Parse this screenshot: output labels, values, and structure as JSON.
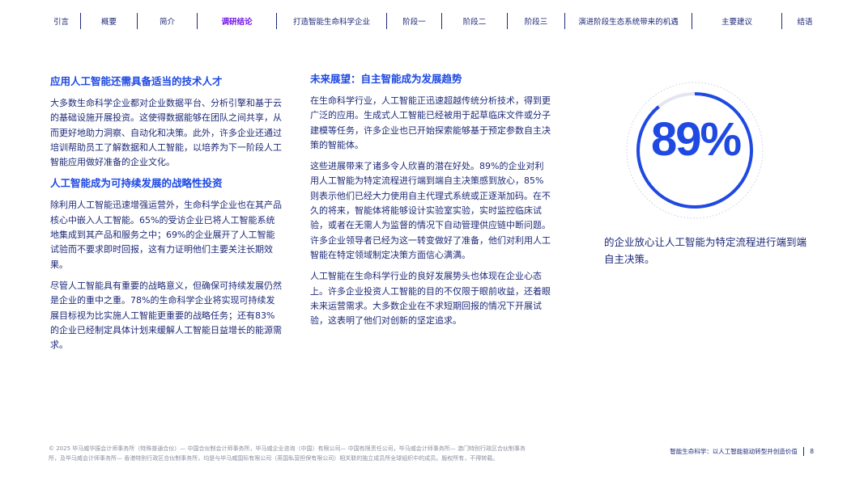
{
  "nav": {
    "items": [
      {
        "label": "引言",
        "w": 48
      },
      {
        "label": "概要",
        "w": 70
      },
      {
        "label": "简介",
        "w": 74
      },
      {
        "label": "调研结论",
        "w": 98,
        "active": true
      },
      {
        "label": "打造智能生命科学企业",
        "w": 136
      },
      {
        "label": "阶段一",
        "w": 68
      },
      {
        "label": "阶段二",
        "w": 81
      },
      {
        "label": "阶段三",
        "w": 71
      },
      {
        "label": "演进阶段生态系统带来的机遇",
        "w": 157
      },
      {
        "label": "主要建议",
        "w": 111
      },
      {
        "label": "结语",
        "w": 56
      }
    ]
  },
  "left": {
    "h1": "应用人工智能还需具备适当的技术人才",
    "p1": "大多数生命科学企业都对企业数据平台、分析引擎和基于云的基础设施开展投资。这使得数据能够在团队之间共享，从而更好地助力洞察、自动化和决策。此外，许多企业还通过培训帮助员工了解数据和人工智能，以培养为下一阶段人工智能应用做好准备的企业文化。",
    "h2": "人工智能成为可持续发展的战略性投资",
    "p2": "除利用人工智能迅速增强运营外，生命科学企业也在其产品核心中嵌入人工智能。65%的受访企业已将人工智能系统地集成到其产品和服务之中；69%的企业展开了人工智能试验而不要求即时回报，这有力证明他们主要关注长期效果。",
    "p3": "尽管人工智能具有重要的战略意义，但确保可持续发展仍然是企业的重中之重。78%的生命科学企业将实现可持续发展目标视为比实施人工智能更重要的战略任务；还有83%的企业已经制定具体计划来缓解人工智能日益增长的能源需求。"
  },
  "mid": {
    "h1": "未来展望：自主智能成为发展趋势",
    "p1": "在生命科学行业，人工智能正迅速超越传统分析技术，得到更广泛的应用。生成式人工智能已经被用于起草临床文件或分子建模等任务，许多企业也已开始探索能够基于预定参数自主决策的智能体。",
    "p2": "这些进展带来了诸多令人欣喜的潜在好处。89%的企业对利用人工智能为特定流程进行端到端自主决策感到放心，85%则表示他们已经大力使用自主代理式系统或正逐渐加码。在不久的将来，智能体将能够设计实验室实验，实时监控临床试验，或者在无需人为监督的情况下自动管理供应链中断问题。许多企业领导者已经为这一转变做好了准备，他们对利用人工智能在特定领域制定决策方面信心满满。",
    "p3": "人工智能在生命科学行业的良好发展势头也体现在企业心态上。许多企业投资人工智能的目的不仅限于眼前收益，还着眼未来运营需求。大多数企业在不求短期回报的情况下开展试验，这表明了他们对创新的坚定追求。"
  },
  "stat": {
    "value_text": "89%",
    "fraction": 0.89,
    "caption": "的企业放心让人工智能为特定流程进行端到端自主决策。",
    "ring_color": "#1e49e2",
    "track_color": "#c9cde3"
  },
  "footer": {
    "legal": "© 2025 毕马威华振会计师事务所（特殊普通合伙）— 中国合伙制会计师事务所，毕马威企业咨询（中国）有限公司— 中国有限责任公司，毕马威会计师事务所— 澳门特别行政区合伙制事务所，及毕马威会计师事务所— 香港特别行政区合伙制事务所，均是与毕马威国际有限公司（英国私营担保有限公司）相关联的独立成员所全球组织中的成员。版权所有，不得转载。",
    "doc_title": "智能生命科学：以人工智能驱动转型并创造价值",
    "page_number": "8"
  },
  "colors": {
    "brand_blue": "#1e49e2",
    "navy": "#1e2a78",
    "purple": "#7213ea"
  }
}
